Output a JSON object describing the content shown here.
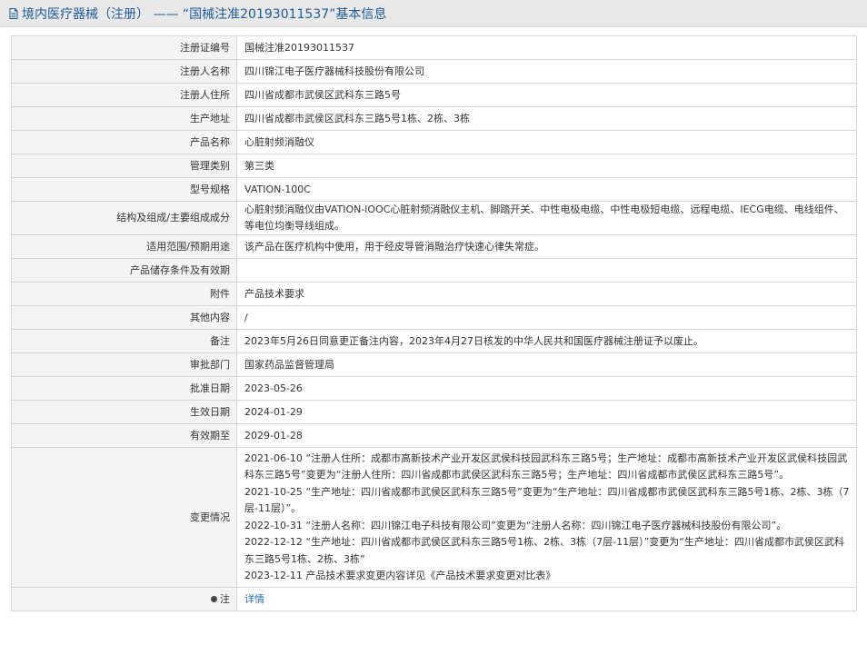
{
  "header": {
    "title": "境内医疗器械（注册） —— “国械注准20193011537”基本信息"
  },
  "rows": [
    {
      "label": "注册证编号",
      "value": "国械注准20193011537"
    },
    {
      "label": "注册人名称",
      "value": "四川锦江电子医疗器械科技股份有限公司"
    },
    {
      "label": "注册人住所",
      "value": "四川省成都市武侯区武科东三路5号"
    },
    {
      "label": "生产地址",
      "value": "四川省成都市武侯区武科东三路5号1栋、2栋、3栋"
    },
    {
      "label": "产品名称",
      "value": "心脏射频消融仪"
    },
    {
      "label": "管理类别",
      "value": "第三类"
    },
    {
      "label": "型号规格",
      "value": "VATION-100C"
    },
    {
      "label": "结构及组成/主要组成成分",
      "value": "心脏射频消融仪由VATION-lOOC心脏射频消融仪主机、脚踏开关、中性电极电缆、中性电极短电缆、远程电缆、IECG电缆、电线组件、等电位均衡导线组成。"
    },
    {
      "label": "适用范围/预期用途",
      "value": "该产品在医疗机构中使用，用于经皮导管消融治疗快速心律失常症。"
    },
    {
      "label": "产品储存条件及有效期",
      "value": ""
    },
    {
      "label": "附件",
      "value": "产品技术要求"
    },
    {
      "label": "其他内容",
      "value": "/"
    },
    {
      "label": "备注",
      "value": "2023年5月26日同意更正备注内容，2023年4月27日核发的中华人民共和国医疗器械注册证予以废止。"
    },
    {
      "label": "审批部门",
      "value": "国家药品监督管理局"
    },
    {
      "label": "批准日期",
      "value": "2023-05-26"
    },
    {
      "label": "生效日期",
      "value": "2024-01-29"
    },
    {
      "label": "有效期至",
      "value": "2029-01-28"
    }
  ],
  "changes": {
    "label": "变更情况",
    "entries": [
      "2021-06-10 “注册人住所：成都市高新技术产业开发区武侯科技园武科东三路5号；生产地址：成都市高新技术产业开发区武侯科技园武科东三路5号”变更为“注册人住所：四川省成都市武侯区武科东三路5号；生产地址：四川省成都市武侯区武科东三路5号”。",
      "2021-10-25 “生产地址：四川省成都市武侯区武科东三路5号”变更为“生产地址：四川省成都市武侯区武科东三路5号1栋、2栋、3栋（7层-11层）”。",
      "2022-10-31 “注册人名称：四川锦江电子科技有限公司”变更为“注册人名称：四川锦江电子医疗器械科技股份有限公司”。",
      "2022-12-12 “生产地址：四川省成都市武侯区武科东三路5号1栋、2栋、3栋（7层-11层）”变更为“生产地址：四川省成都市武侯区武科东三路5号1栋、2栋、3栋”",
      "2023-12-11 产品技术要求变更内容详见《产品技术要求变更对比表》"
    ]
  },
  "note": {
    "label": "注",
    "link": "详情"
  },
  "colors": {
    "title": "#1f5b99",
    "link": "#1f6fb5",
    "label_bg": "#f4f4f4",
    "border": "#d6d6d6"
  }
}
